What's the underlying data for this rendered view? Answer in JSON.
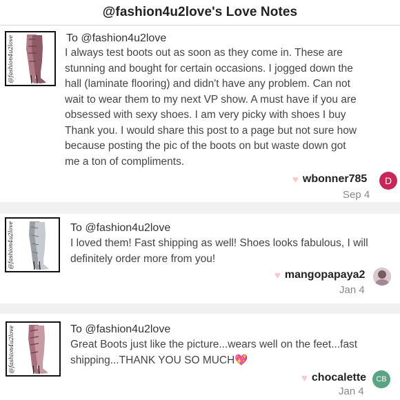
{
  "header": {
    "title": "@fashion4u2love's Love Notes"
  },
  "notes": [
    {
      "to": "To @fashion4u2love",
      "thumb_brand": "@fashion4u2love",
      "body_lines": [
        "I always test boots out as soon as they come in. These are",
        "stunning and bought for certain occasions. I jogged down the",
        "hall (laminate flooring) and didn't have any problem. Can not",
        "wait to wear them to my next VP show. A must have if you are",
        "obsessed with sexy shoes. I am very picky with shoes I buy",
        "Thank you. I would share this post to a page but not sure how",
        "because posting the pic of the boots on but waste down got",
        "me a ton of compliments."
      ],
      "username": "wbonner785",
      "date": "Sep 4",
      "avatar_text": "D",
      "avatar_color": "#c8275a",
      "boot_color": "#b07a86"
    },
    {
      "to": "To @fashion4u2love",
      "thumb_brand": "@fashion4u2love",
      "body_lines": [
        "I loved them! Fast shipping as well! Shoes looks fabulous, I will",
        "definitely order more from you!"
      ],
      "username": "mangopapaya2",
      "date": "Jan 4",
      "avatar_text": "",
      "avatar_color": "#b9a9b0",
      "boot_color": "#9aa0a6"
    },
    {
      "to": "To @fashion4u2love",
      "thumb_brand": "@fashion4u2love",
      "body_lines": [
        "Great Boots just like the picture...wears well on the feet...fast",
        "shipping...THANK YOU SO MUCH💖"
      ],
      "username": "chocalette",
      "date": "Jan 4",
      "avatar_text": "CB",
      "avatar_color": "#5aa482",
      "boot_color": "#a8707e"
    }
  ],
  "icons": {
    "like": "heart-icon"
  }
}
